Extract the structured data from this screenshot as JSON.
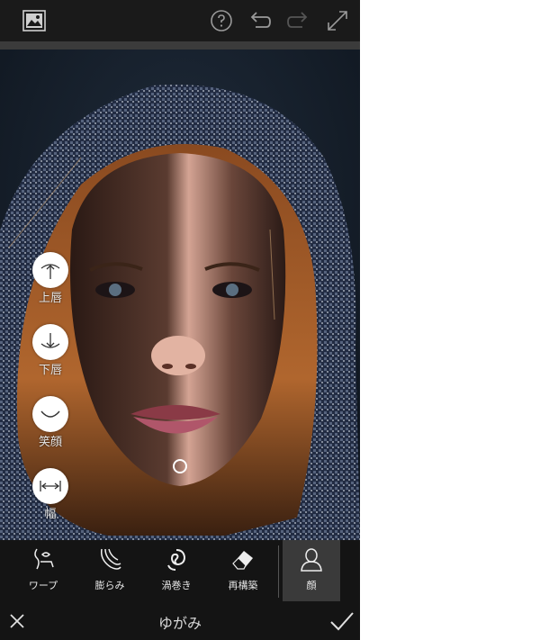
{
  "toolbar": {
    "icons": [
      "gallery-icon",
      "help-icon",
      "undo-icon",
      "redo-icon",
      "fullscreen-icon"
    ]
  },
  "face_tools": [
    {
      "label": "上唇",
      "icon": "arrow-up-icon"
    },
    {
      "label": "下唇",
      "icon": "arrow-down-icon"
    },
    {
      "label": "笑顔",
      "icon": "smile-icon"
    },
    {
      "label": "幅",
      "icon": "width-icon"
    }
  ],
  "tools": [
    {
      "label": "ワープ",
      "icon": "warp-icon"
    },
    {
      "label": "膨らみ",
      "icon": "bloat-icon"
    },
    {
      "label": "渦巻き",
      "icon": "swirl-icon"
    },
    {
      "label": "再構築",
      "icon": "eraser-icon"
    },
    {
      "label": "顔",
      "icon": "face-icon",
      "active": true
    }
  ],
  "bottom": {
    "title": "ゆがみ",
    "cancel_icon": "close-icon",
    "apply_icon": "check-icon"
  },
  "colors": {
    "accent_active": "#3a3a3a",
    "hood": "#3a4a6a",
    "hair": "#b0662e"
  }
}
